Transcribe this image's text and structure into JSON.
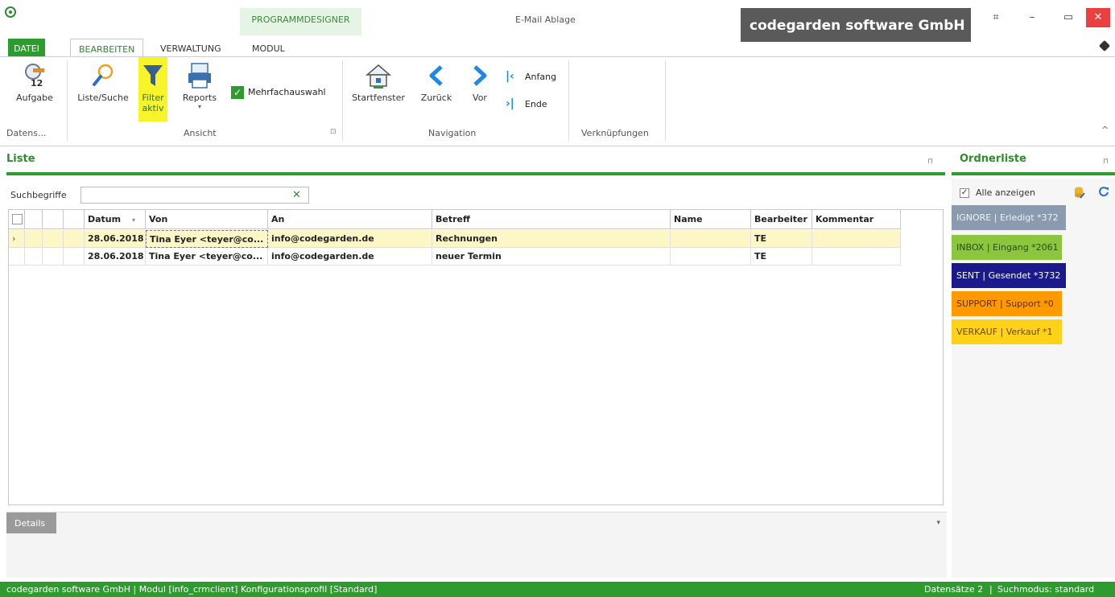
{
  "window": {
    "context_tab": "PROGRAMMDESIGNER",
    "title": "E-Mail Ablage",
    "company": "codegarden software GmbH",
    "controls": {
      "restore": "⌗",
      "minimize": "–",
      "maximize": "▭",
      "close": "✕"
    }
  },
  "tabs": [
    {
      "label": "DATEI"
    },
    {
      "label": "BEARBEITEN"
    },
    {
      "label": "VERWALTUNG"
    },
    {
      "label": "MODUL"
    }
  ],
  "ribbon": {
    "aufgabe": {
      "label": "Aufgabe",
      "badge": "12"
    },
    "liste_suche": {
      "label": "Liste/Suche"
    },
    "filter": {
      "label": "Filter",
      "label2": "aktiv"
    },
    "reports": {
      "label": "Reports",
      "arrow": "▾"
    },
    "mehrfachauswahl": {
      "label": "Mehrfachauswahl",
      "check": "✓"
    },
    "startfenster": {
      "label": "Startfenster"
    },
    "zurueck": {
      "label": "Zurück"
    },
    "vor": {
      "label": "Vor"
    },
    "anfang": {
      "label": "Anfang"
    },
    "ende": {
      "label": "Ende"
    },
    "groups": {
      "datens": "Datens...",
      "ansicht": "Ansicht",
      "navigation": "Navigation",
      "verknuepfungen": "Verknüpfungen"
    },
    "collapse_glyph": "^",
    "launcher_glyph": "⊡"
  },
  "liste": {
    "title": "Liste",
    "pin": "⊓",
    "search_label": "Suchbegriffe",
    "search_value": "",
    "clear_glyph": "✕",
    "columns": [
      "Datum",
      "Von",
      "An",
      "Betreff",
      "Name",
      "Bearbeiter",
      "Kommentar"
    ],
    "sort_glyph": "▾",
    "row_indicator": "›",
    "rows": [
      {
        "datum": "28.06.2018",
        "von": "Tina Eyer <teyer@co...",
        "an": "info@codegarden.de",
        "betreff": "Rechnungen",
        "name": "",
        "bearbeiter": "TE",
        "kommentar": ""
      },
      {
        "datum": "28.06.2018",
        "von": "Tina Eyer <teyer@co...",
        "an": "info@codegarden.de",
        "betreff": "neuer Termin",
        "name": "",
        "bearbeiter": "TE",
        "kommentar": ""
      }
    ]
  },
  "details": {
    "tab": "Details",
    "arrow": "▾"
  },
  "ordnerliste": {
    "title": "Ordnerliste",
    "pin": "⊓",
    "alle_anzeigen": "Alle anzeigen",
    "alle_check": "✓",
    "folders": [
      {
        "label": "IGNORE | Erledigt *372",
        "color": "#8a9bb0",
        "text_color": "#eef2f7"
      },
      {
        "label": "INBOX | Eingang *2061",
        "color": "#8cc63f",
        "text_color": "#2b4a10"
      },
      {
        "label": "SENT | Gesendet *3732",
        "color": "#1a1a8c",
        "text_color": "#ffffff"
      },
      {
        "label": "SUPPORT | Support *0",
        "color": "#ff9900",
        "text_color": "#5a3000"
      },
      {
        "label": "VERKAUF | Verkauf *1",
        "color": "#ffd21a",
        "text_color": "#6a4a00"
      }
    ]
  },
  "statusbar": {
    "left": "codegarden software GmbH  |  Modul [info_crmclient]  Konfigurationsprofil [Standard]",
    "datensaetze": "Datensätze 2",
    "suchmodus": "Suchmodus: standard"
  },
  "colors": {
    "accent": "#2e9b2e",
    "selected_row": "#fdf7c7",
    "filter_highlight": "#f8f42a"
  }
}
